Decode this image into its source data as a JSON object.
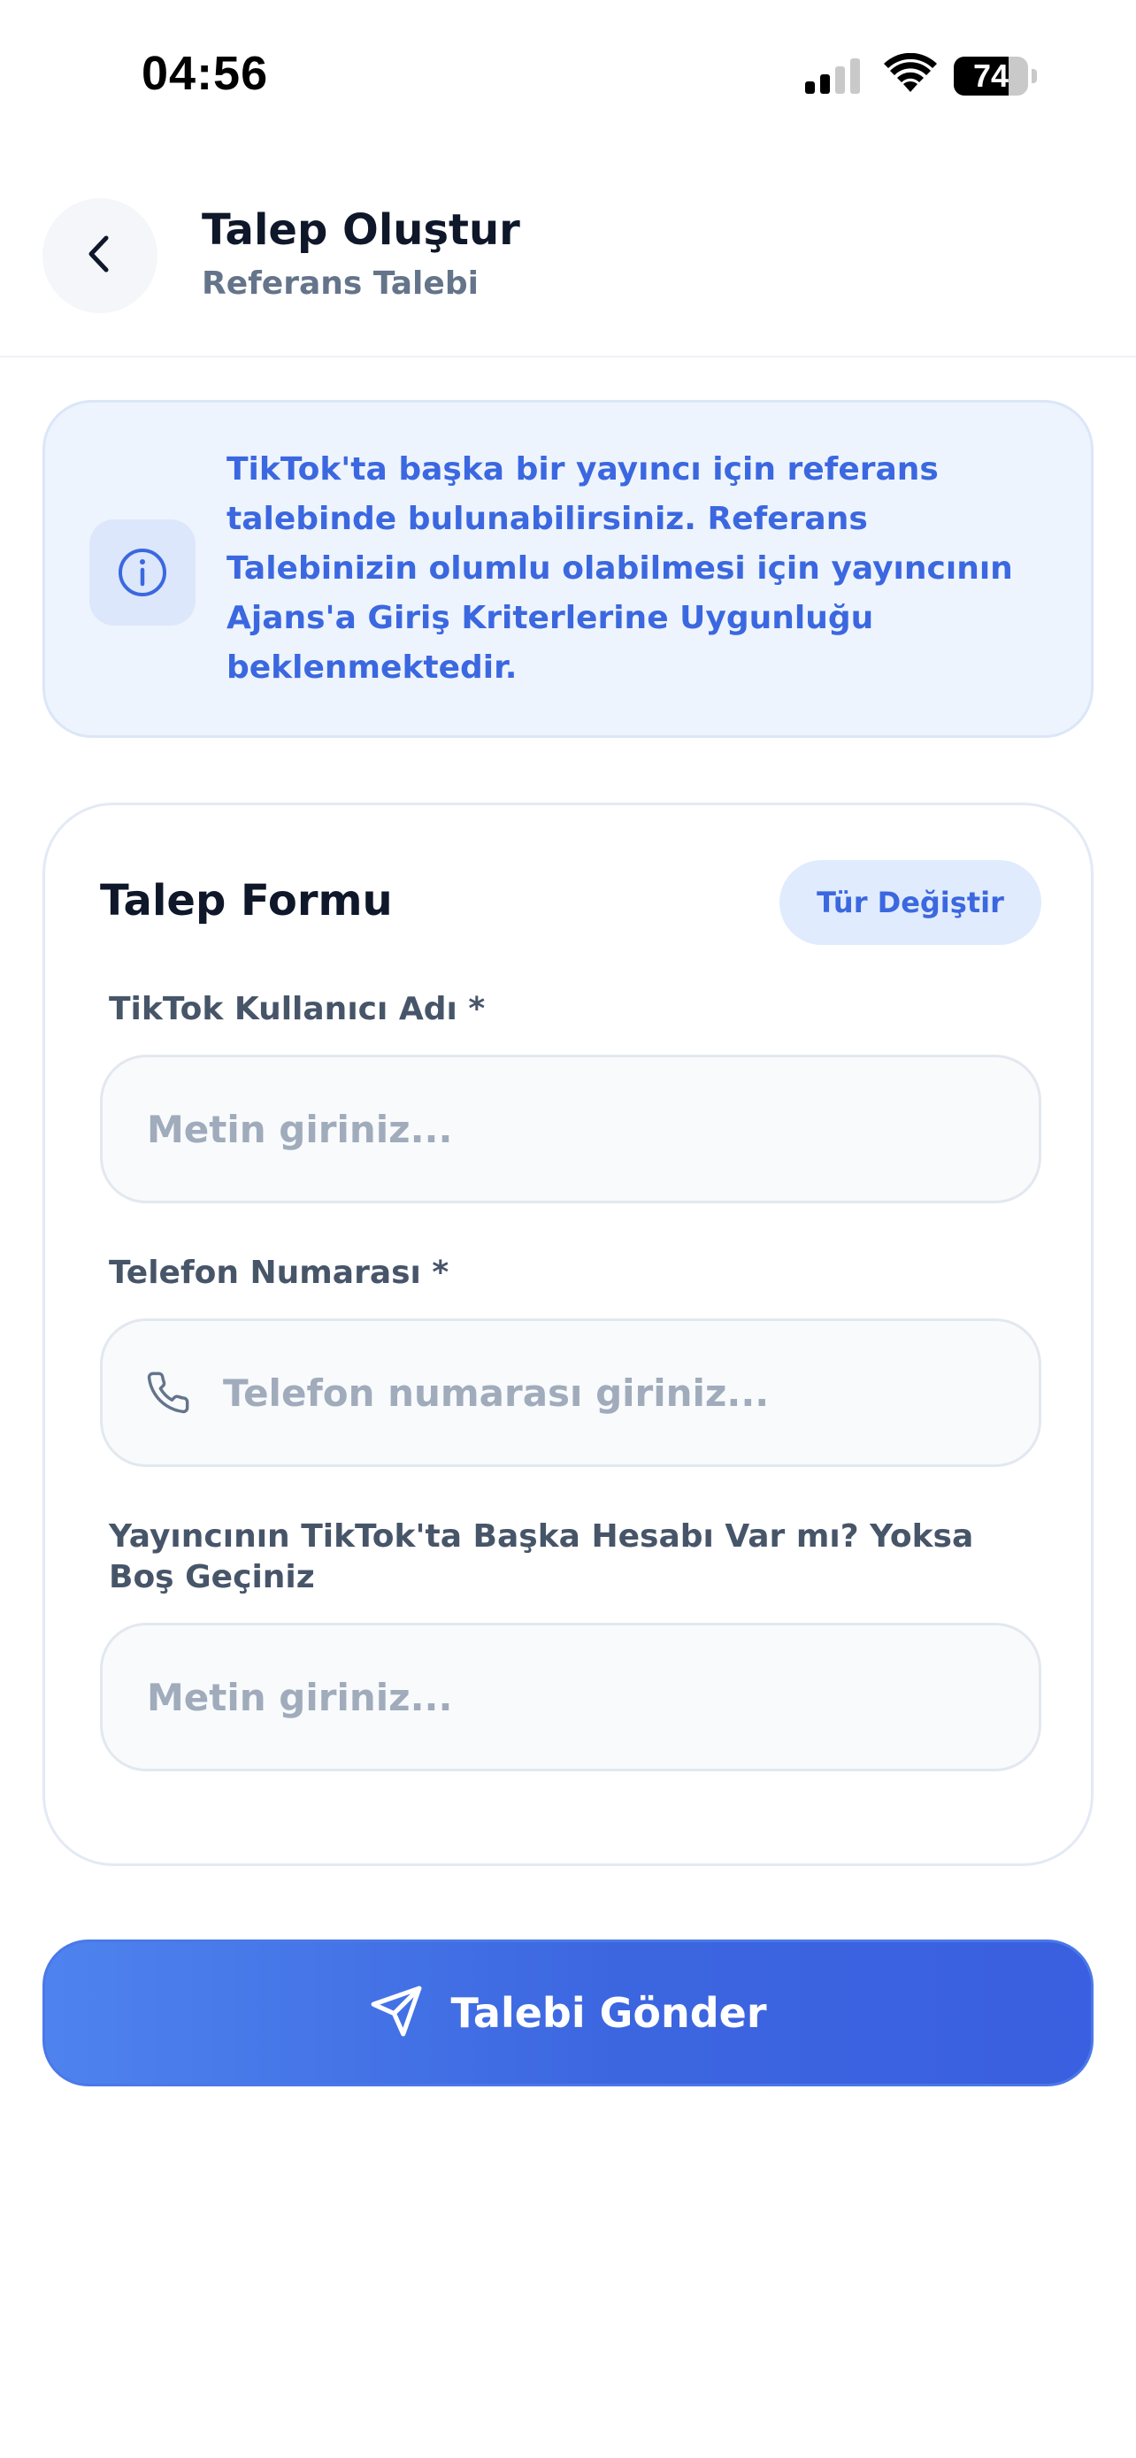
{
  "status_bar": {
    "time": "04:56",
    "battery": "74",
    "battery_level": 0.74,
    "icons": [
      "signal-icon",
      "wifi-icon",
      "battery-icon"
    ]
  },
  "header": {
    "title": "Talep Oluştur",
    "subtitle": "Referans Talebi",
    "back_icon": "chevron-left-icon"
  },
  "info": {
    "icon": "info-icon",
    "text": "TikTok'ta başka bir yayıncı için referans talebinde bulunabilirsiniz. Referans Talebinizin olumlu olabilmesi için yayıncının Ajans'a Giriş Kriterlerine Uygunluğu beklenmektedir."
  },
  "form": {
    "title": "Talep Formu",
    "change_type_label": "Tür Değiştir",
    "fields": [
      {
        "label": "TikTok Kullanıcı Adı *",
        "placeholder": "Metin giriniz..."
      },
      {
        "label": "Telefon Numarası *",
        "placeholder": "Telefon numarası giriniz...",
        "icon": "phone-icon"
      },
      {
        "label": "Yayıncının TikTok'ta Başka Hesabı Var mı? Yoksa Boş Geçiniz",
        "placeholder": "Metin giriniz..."
      }
    ]
  },
  "submit": {
    "label": "Talebi Gönder",
    "icon": "send-icon"
  },
  "colors": {
    "accent": "#3B68E0",
    "info_bg": "#EEF4FE",
    "title": "#0F172A",
    "label": "#475569",
    "placeholder": "#A0ABBB"
  }
}
